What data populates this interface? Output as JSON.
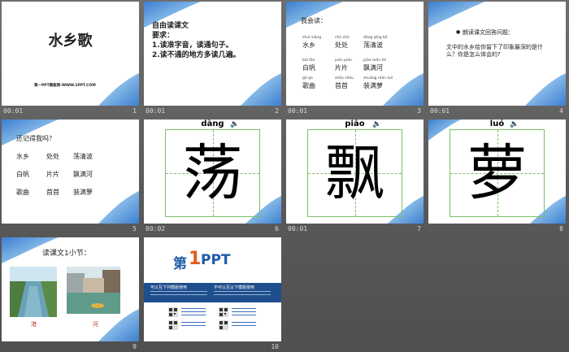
{
  "slides": [
    {
      "num": "1",
      "time": "00:01",
      "title": "水乡歌",
      "footer": "第一PPT模板网-WWW.1PPT.COM"
    },
    {
      "num": "2",
      "time": "00:01",
      "lines": [
        "自由读课文",
        "要求：",
        "1.读准字音，读通句子。",
        "2.读不通的地方多读几遍。"
      ]
    },
    {
      "num": "3",
      "time": "00:01",
      "heading": "我会读：",
      "words": [
        {
          "pinyin": "shuǐ xiāng",
          "hanzi": "水乡"
        },
        {
          "pinyin": "chù chù",
          "hanzi": "处处"
        },
        {
          "pinyin": "dàng qīng bō",
          "hanzi": "荡清波"
        },
        {
          "pinyin": "bái fān",
          "hanzi": "白帆"
        },
        {
          "pinyin": "piàn piàn",
          "hanzi": "片片"
        },
        {
          "pinyin": "piāo mǎn hé",
          "hanzi": "飘满河"
        },
        {
          "pinyin": "gē qǔ",
          "hanzi": "歌曲"
        },
        {
          "pinyin": "shǒu shǒu",
          "hanzi": "首首"
        },
        {
          "pinyin": "zhuāng mǎn luó",
          "hanzi": "装满萝"
        }
      ]
    },
    {
      "num": "4",
      "time": "00:01",
      "bullet": "朗读课文回答问题：",
      "question": "文中的水乡给你留下了印象最深的是什么？你是怎么体会的?"
    },
    {
      "num": "5",
      "time": "",
      "heading": "还记得我吗？",
      "words": [
        "水乡",
        "处处",
        "荡清波",
        "白帆",
        "片片",
        "飘满河",
        "歌曲",
        "首首",
        "装满箩"
      ]
    },
    {
      "num": "6",
      "time": "00:02",
      "pinyin": "dàng",
      "hanzi": "荡"
    },
    {
      "num": "7",
      "time": "00:01",
      "pinyin": "piāo",
      "hanzi": "飘"
    },
    {
      "num": "8",
      "time": "",
      "pinyin": "luó",
      "hanzi": "萝"
    },
    {
      "num": "9",
      "time": "",
      "heading": "读课文1小节：",
      "captions": [
        "港",
        "河"
      ]
    },
    {
      "num": "10",
      "time": "",
      "logo_prefix": "第",
      "logo_num": "1",
      "logo_suffix": "PPT",
      "left_head": "可以互下列模版使用",
      "right_head": "不可以互以下模版使用"
    }
  ],
  "colors": {
    "accent_blue": "#1f4e8c",
    "grid_green": "#7bbf6a",
    "wash_blue": "#6fa8dc",
    "selected": "#f2c94c"
  }
}
